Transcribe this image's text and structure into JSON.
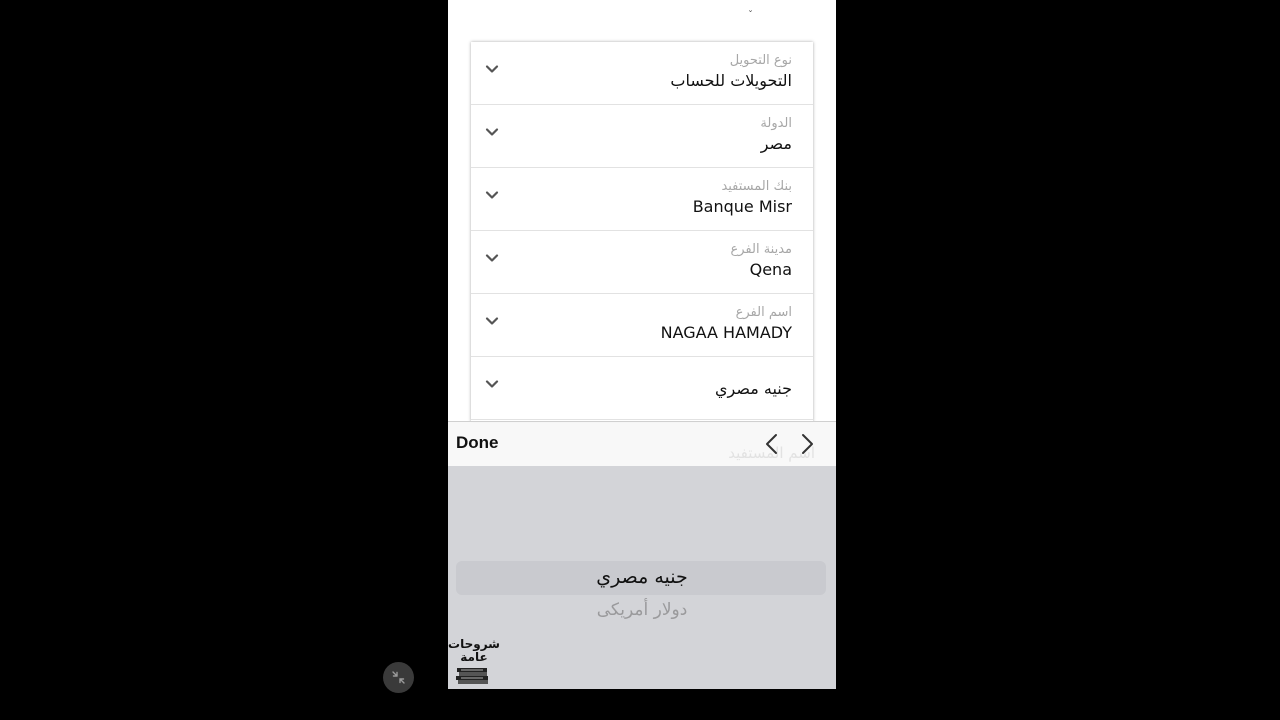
{
  "status_mark": "ˇ",
  "form": {
    "fields": [
      {
        "label": "نوع التحويل",
        "value": "التحويلات للحساب"
      },
      {
        "label": "الدولة",
        "value": "مصر"
      },
      {
        "label": "بنك المستفيد",
        "value": "Banque Misr"
      },
      {
        "label": "مدينة الفرع",
        "value": "Qena"
      },
      {
        "label": "اسم الفرع",
        "value": "NAGAA HAMADY"
      },
      {
        "label": "",
        "value": "جنيه مصري"
      }
    ],
    "ghost_label": "اسم المستفيد"
  },
  "toolbar": {
    "done_label": "Done"
  },
  "picker": {
    "selected": "جنيه مصري",
    "options": [
      "دولار أمريكى"
    ]
  },
  "watermark": {
    "line1": "شروحات",
    "line2": "عامة"
  },
  "icons": {
    "chevron": "chevron-down-icon",
    "prev": "chevron-left-icon",
    "next": "chevron-right-icon",
    "exit": "exit-fullscreen-icon"
  },
  "colors": {
    "background": "#000000",
    "picker_bg": "#d3d4d8",
    "label_gray": "#a7a7a7"
  }
}
